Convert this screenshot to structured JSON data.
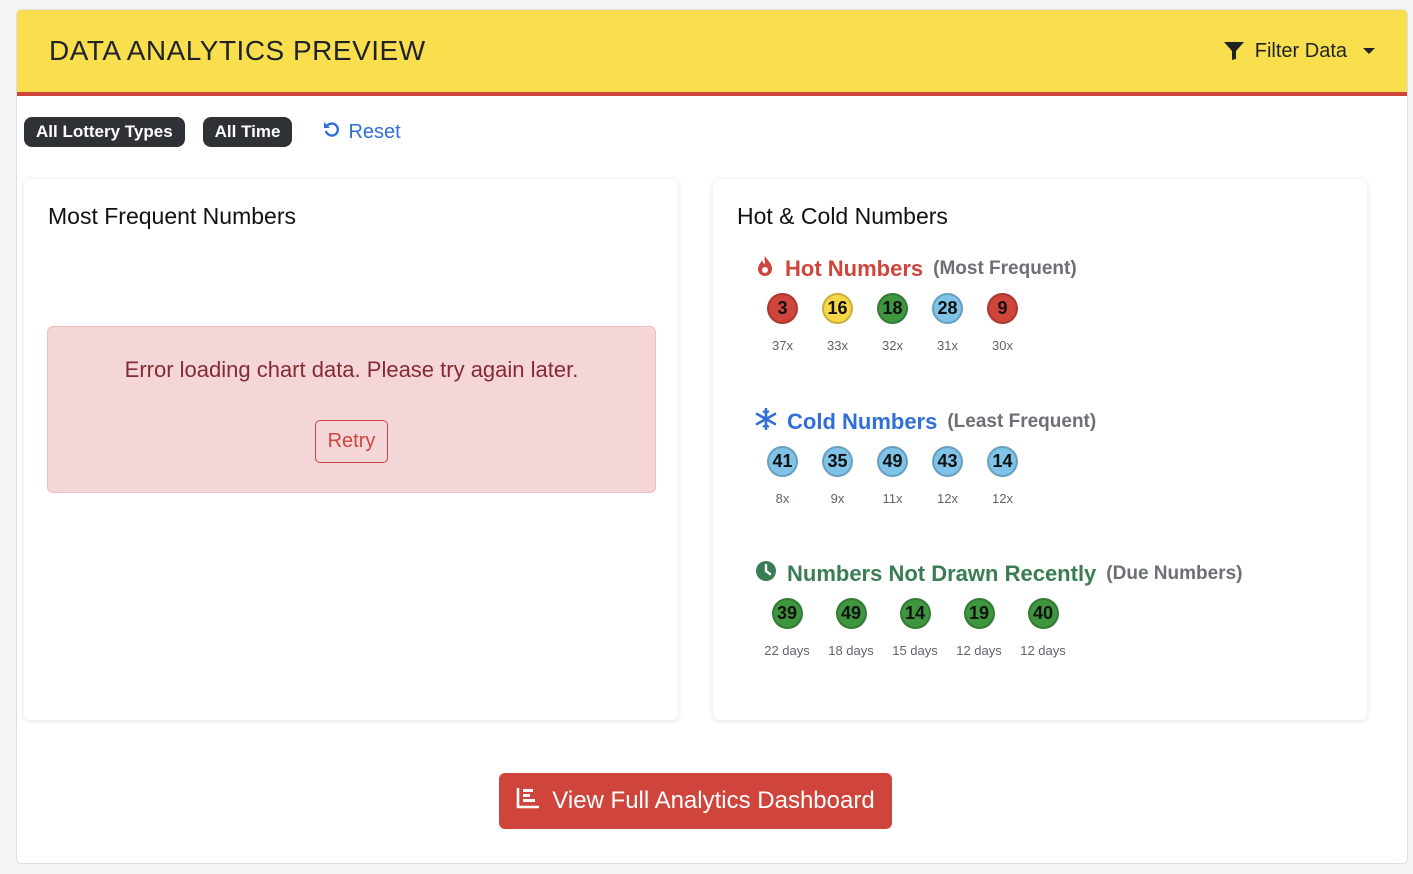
{
  "header": {
    "title": "DATA ANALYTICS PREVIEW",
    "filter_label": "Filter Data"
  },
  "filters": {
    "tags": [
      "All Lottery Types",
      "All Time"
    ],
    "reset_label": "Reset"
  },
  "left_panel": {
    "title": "Most Frequent Numbers",
    "error_message": "Error loading chart data. Please try again later.",
    "retry_label": "Retry"
  },
  "right_panel": {
    "title": "Hot & Cold Numbers",
    "hot": {
      "title": "Hot Numbers",
      "subtitle": "(Most Frequent)",
      "balls": [
        {
          "n": "3",
          "label": "37x",
          "color": "red"
        },
        {
          "n": "16",
          "label": "33x",
          "color": "yellow"
        },
        {
          "n": "18",
          "label": "32x",
          "color": "green"
        },
        {
          "n": "28",
          "label": "31x",
          "color": "blue"
        },
        {
          "n": "9",
          "label": "30x",
          "color": "red"
        }
      ]
    },
    "cold": {
      "title": "Cold Numbers",
      "subtitle": "(Least Frequent)",
      "balls": [
        {
          "n": "41",
          "label": "8x",
          "color": "blue"
        },
        {
          "n": "35",
          "label": "9x",
          "color": "blue"
        },
        {
          "n": "49",
          "label": "11x",
          "color": "blue"
        },
        {
          "n": "43",
          "label": "12x",
          "color": "blue"
        },
        {
          "n": "14",
          "label": "12x",
          "color": "blue"
        }
      ]
    },
    "due": {
      "title": "Numbers Not Drawn Recently",
      "subtitle": "(Due Numbers)",
      "balls": [
        {
          "n": "39",
          "label": "22 days",
          "color": "green"
        },
        {
          "n": "49",
          "label": "18 days",
          "color": "green"
        },
        {
          "n": "14",
          "label": "15 days",
          "color": "green"
        },
        {
          "n": "19",
          "label": "12 days",
          "color": "green"
        },
        {
          "n": "40",
          "label": "12 days",
          "color": "green"
        }
      ]
    }
  },
  "footer": {
    "button_label": "View Full Analytics Dashboard"
  },
  "colors": {
    "header_bg": "#f9de4e",
    "accent_red": "#d0453b",
    "link_blue": "#2f6fd6",
    "hot_red": "#d0453b",
    "cold_blue": "#2f6fd6",
    "due_green": "#3a7d54"
  }
}
